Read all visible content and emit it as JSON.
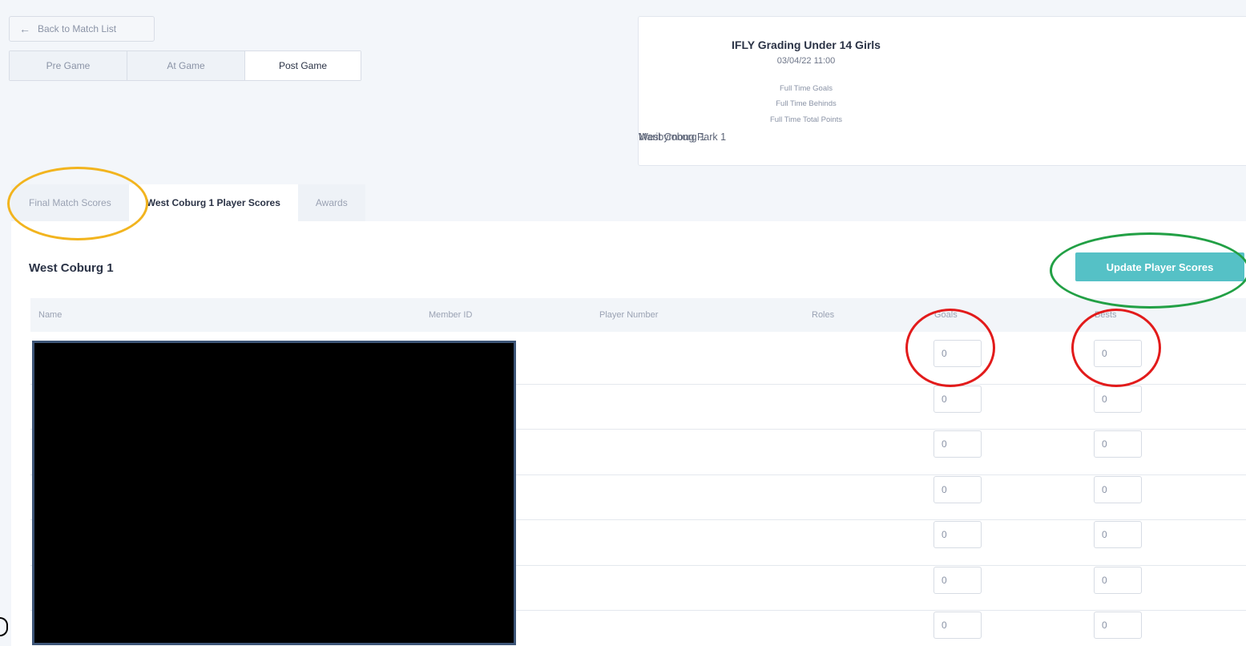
{
  "back": {
    "label": "Back to Match List"
  },
  "phase_tabs": [
    "Pre Game",
    "At Game",
    "Post Game"
  ],
  "match": {
    "title": "IFLY Grading Under 14 Girls",
    "datetime": "03/04/22 11:00",
    "lines": [
      "Full Time Goals",
      "Full Time Behinds",
      "Full Time Total Points"
    ],
    "home_team": "Maribyrnong Park 1",
    "away_team": "West Coburg 1"
  },
  "sub_tabs": [
    "Final Match Scores",
    "West Coburg 1 Player Scores",
    "Awards"
  ],
  "section": {
    "title": "West Coburg 1",
    "update_button": "Update Player Scores"
  },
  "table": {
    "columns": [
      "Name",
      "Member ID",
      "Player Number",
      "Roles",
      "Goals",
      "Bests"
    ],
    "rows": [
      {
        "goals": "0",
        "bests": "0"
      },
      {
        "goals": "0",
        "bests": "0"
      },
      {
        "goals": "0",
        "bests": "0"
      },
      {
        "goals": "0",
        "bests": "0"
      },
      {
        "goals": "0",
        "bests": "0"
      },
      {
        "goals": "0",
        "bests": "0"
      },
      {
        "goals": "0",
        "bests": "0"
      }
    ]
  },
  "icons": {
    "back": "arrow-left-icon"
  },
  "colors": {
    "accent_button": "#55c1c6",
    "annotation_yellow": "#f2b41e",
    "annotation_green": "#22a045",
    "annotation_red": "#e21b1b"
  }
}
